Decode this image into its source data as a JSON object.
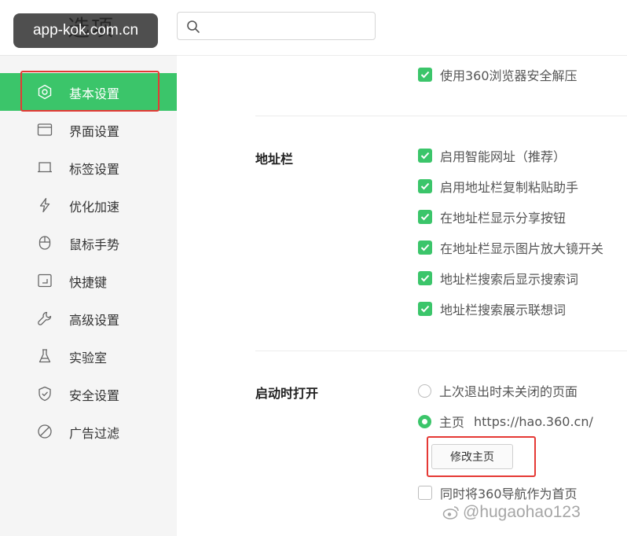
{
  "header": {
    "title": "选项",
    "search_placeholder": "",
    "watermark_site": "app-kok.com.cn"
  },
  "sidebar": {
    "items": [
      {
        "label": "基本设置",
        "icon": "hexagon-settings-icon",
        "active": true
      },
      {
        "label": "界面设置",
        "icon": "window-icon"
      },
      {
        "label": "标签设置",
        "icon": "tab-icon"
      },
      {
        "label": "优化加速",
        "icon": "lightning-icon"
      },
      {
        "label": "鼠标手势",
        "icon": "mouse-icon"
      },
      {
        "label": "快捷键",
        "icon": "shortcut-key-icon"
      },
      {
        "label": "高级设置",
        "icon": "wrench-icon"
      },
      {
        "label": "实验室",
        "icon": "flask-icon"
      },
      {
        "label": "安全设置",
        "icon": "shield-icon"
      },
      {
        "label": "广告过滤",
        "icon": "block-icon"
      }
    ]
  },
  "main": {
    "top_option": {
      "label": "使用360浏览器安全解压",
      "checked": true
    },
    "address_bar": {
      "title": "地址栏",
      "options": [
        {
          "label": "启用智能网址（推荐）",
          "checked": true
        },
        {
          "label": "启用地址栏复制粘贴助手",
          "checked": true
        },
        {
          "label": "在地址栏显示分享按钮",
          "checked": true
        },
        {
          "label": "在地址栏显示图片放大镜开关",
          "checked": true
        },
        {
          "label": "地址栏搜索后显示搜索词",
          "checked": true
        },
        {
          "label": "地址栏搜索展示联想词",
          "checked": true
        }
      ]
    },
    "startup": {
      "title": "启动时打开",
      "radio_last": "上次退出时未关闭的页面",
      "radio_home": "主页",
      "home_url": "https://hao.360.cn/",
      "edit_home_button": "修改主页",
      "nav_as_home": "同时将360导航作为首页",
      "selected": "home",
      "nav_as_home_checked": false
    }
  },
  "watermark": {
    "text": "@hugaohao123"
  },
  "colors": {
    "accent": "#3bc56a",
    "highlight_frame": "#e53935"
  }
}
